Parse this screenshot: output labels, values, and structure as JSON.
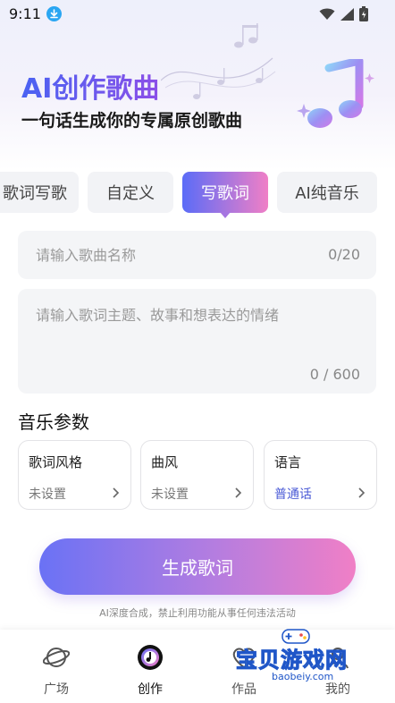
{
  "status_bar": {
    "time": "9:11",
    "icons": [
      "download-icon",
      "wifi-icon",
      "signal-icon",
      "battery-icon"
    ]
  },
  "hero": {
    "title": "AI创作歌曲",
    "subtitle": "一句话生成你的专属原创歌曲"
  },
  "mode_tabs": [
    {
      "label": "歌词写歌",
      "active": false
    },
    {
      "label": "自定义",
      "active": false
    },
    {
      "label": "写歌词",
      "active": true
    },
    {
      "label": "AI纯音乐",
      "active": false
    }
  ],
  "song_name": {
    "placeholder": "请输入歌曲名称",
    "value": "",
    "counter": "0/20"
  },
  "lyrics": {
    "placeholder": "请输入歌词主题、故事和想表达的情绪",
    "value": "",
    "counter": "0 / 600"
  },
  "params": {
    "title": "音乐参数",
    "items": [
      {
        "label": "歌词风格",
        "value": "未设置",
        "accent": false
      },
      {
        "label": "曲风",
        "value": "未设置",
        "accent": false
      },
      {
        "label": "语言",
        "value": "普通话",
        "accent": true
      }
    ]
  },
  "generate": {
    "label": "生成歌词",
    "disclaimer": "AI深度合成，禁止利用功能从事任何违法活动"
  },
  "bottom_nav": [
    {
      "label": "广场",
      "icon": "planet-icon",
      "active": false
    },
    {
      "label": "创作",
      "icon": "music-disc-icon",
      "active": true
    },
    {
      "label": "作品",
      "icon": "heart-icon",
      "active": false
    },
    {
      "label": "我的",
      "icon": "profile-icon",
      "active": false
    }
  ],
  "watermark": {
    "text": "宝贝游戏网",
    "url": "baobeiy.com"
  },
  "colors": {
    "accent_start": "#5b6cf7",
    "accent_end": "#f07fc6",
    "accent_text": "#4b5bd6"
  }
}
